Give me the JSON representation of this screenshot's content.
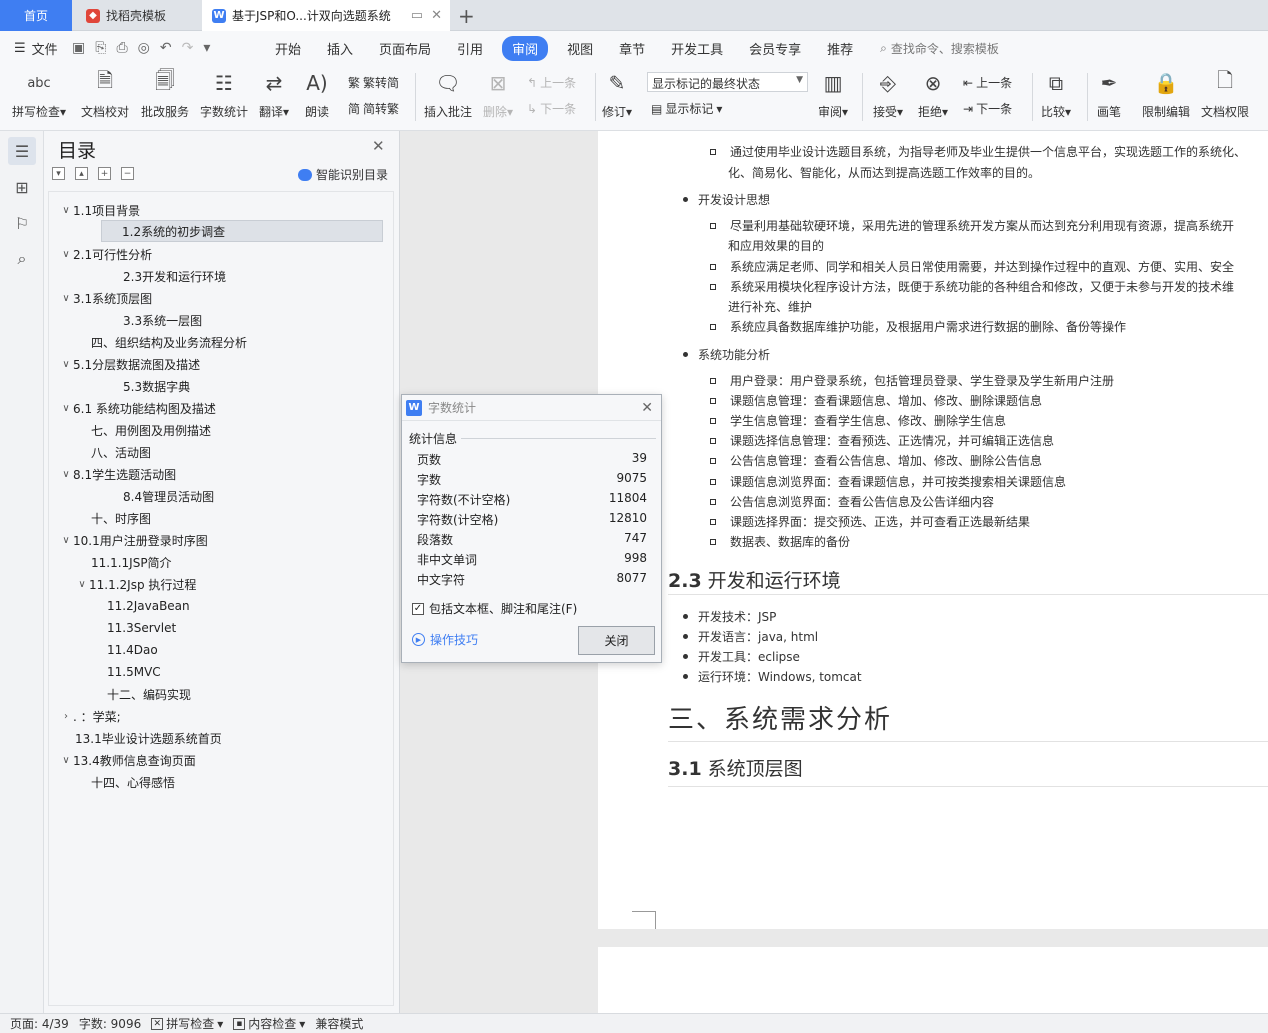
{
  "tabs": [
    {
      "label": "首页"
    },
    {
      "label": "找稻壳模板"
    },
    {
      "label": "基于JSP和O...计双向选题系统"
    }
  ],
  "menu": {
    "file": "文件",
    "tabs": [
      "开始",
      "插入",
      "页面布局",
      "引用",
      "审阅",
      "视图",
      "章节",
      "开发工具",
      "会员专享",
      "推荐"
    ],
    "active": "审阅",
    "search": "查找命令、搜索模板"
  },
  "ribbon": {
    "spell": "拼写检查",
    "proofread": "文档校对",
    "review_service": "批改服务",
    "word_count": "字数统计",
    "translate": "翻译",
    "read_aloud": "朗读",
    "to_simplified": "繁转简",
    "to_traditional": "简转繁",
    "insert_comment": "插入批注",
    "delete": "删除",
    "prev_comment": "上一条",
    "next_comment": "下一条",
    "track": "修订",
    "markup_state": "显示标记的最终状态",
    "show_markup": "显示标记",
    "review_pane": "审阅",
    "accept": "接受",
    "reject": "拒绝",
    "prev_change": "上一条",
    "next_change": "下一条",
    "compare": "比较",
    "pen": "画笔",
    "restrict_edit": "限制编辑",
    "doc_permission": "文档权限"
  },
  "toc": {
    "title": "目录",
    "smart": "智能识别目录",
    "items": [
      {
        "label": "1.1项目背景"
      },
      {
        "label": "1.2系统的初步调查"
      },
      {
        "label": "2.1可行性分析"
      },
      {
        "label": "2.3开发和运行环境"
      },
      {
        "label": "3.1系统顶层图"
      },
      {
        "label": "3.3系统一层图"
      },
      {
        "label": "四、组织结构及业务流程分析"
      },
      {
        "label": "5.1分层数据流图及描述"
      },
      {
        "label": "5.3数据字典"
      },
      {
        "label": "6.1 系统功能结构图及描述"
      },
      {
        "label": "七、用例图及用例描述"
      },
      {
        "label": "八、活动图"
      },
      {
        "label": "8.1学生选题活动图"
      },
      {
        "label": "8.4管理员活动图"
      },
      {
        "label": "十、时序图"
      },
      {
        "label": "10.1用户注册登录时序图"
      },
      {
        "label": "11.1.1JSP简介"
      },
      {
        "label": "11.1.2Jsp 执行过程"
      },
      {
        "label": "11.2JavaBean"
      },
      {
        "label": "11.3Servlet"
      },
      {
        "label": "11.4Dao"
      },
      {
        "label": "11.5MVC"
      },
      {
        "label": "十二、编码实现"
      },
      {
        "label": ". ：学菜;"
      },
      {
        "label": "13.1毕业设计选题系统首页"
      },
      {
        "label": "13.4教师信息查询页面"
      },
      {
        "label": "十四、心得感悟"
      }
    ]
  },
  "dialog": {
    "title": "字数统计",
    "group": "统计信息",
    "rows": [
      {
        "label": "页数",
        "value": "39"
      },
      {
        "label": "字数",
        "value": "9075"
      },
      {
        "label": "字符数(不计空格)",
        "value": "11804"
      },
      {
        "label": "字符数(计空格)",
        "value": "12810"
      },
      {
        "label": "段落数",
        "value": "747"
      },
      {
        "label": "非中文单词",
        "value": "998"
      },
      {
        "label": "中文字符",
        "value": "8077"
      }
    ],
    "include": "包括文本框、脚注和尾注(F)",
    "tips": "操作技巧",
    "close": "关闭"
  },
  "doc": {
    "lines": [
      "通过使用毕业设计选题目系统，为指导老师及毕业生提供一个信息平台，实现选题工作的系统化、",
      "化、简易化、智能化，从而达到提高选题工作效率的目的。",
      "开发设计思想",
      "尽量利用基础软硬环境，采用先进的管理系统开发方案从而达到充分利用现有资源，提高系统开",
      "和应用效果的目的",
      "系统应满足老师、同学和相关人员日常使用需要，并达到操作过程中的直观、方便、实用、安全",
      "系统采用模块化程序设计方法，既便于系统功能的各种组合和修改，又便于未参与开发的技术维",
      "进行补充、维护",
      "系统应具备数据库维护功能，及根据用户需求进行数据的删除、备份等操作",
      "系统功能分析",
      "用户登录：用户登录系统，包括管理员登录、学生登录及学生新用户注册",
      "课题信息管理：查看课题信息、增加、修改、删除课题信息",
      "学生信息管理：查看学生信息、修改、删除学生信息",
      "课题选择信息管理：查看预选、正选情况，并可编辑正选信息",
      "公告信息管理：查看公告信息、增加、修改、删除公告信息",
      "课题信息浏览界面：查看课题信息，并可按类搜索相关课题信息",
      "公告信息浏览界面：查看公告信息及公告详细内容",
      "课题选择界面：提交预选、正选，并可查看正选最新结果",
      "数据表、数据库的备份",
      "开发技术：JSP",
      "开发语言：java, html",
      "开发工具：eclipse",
      "运行环境：Windows, tomcat"
    ],
    "h23_num": "2.3",
    "h23_text": "开发和运行环境",
    "h3": "三、系统需求分析",
    "h31_num": "3.1",
    "h31_text": "系统顶层图"
  },
  "status": {
    "page": "页面: 4/39",
    "words": "字数: 9096",
    "spell": "拼写检查",
    "content": "内容检查",
    "compat": "兼容模式"
  }
}
